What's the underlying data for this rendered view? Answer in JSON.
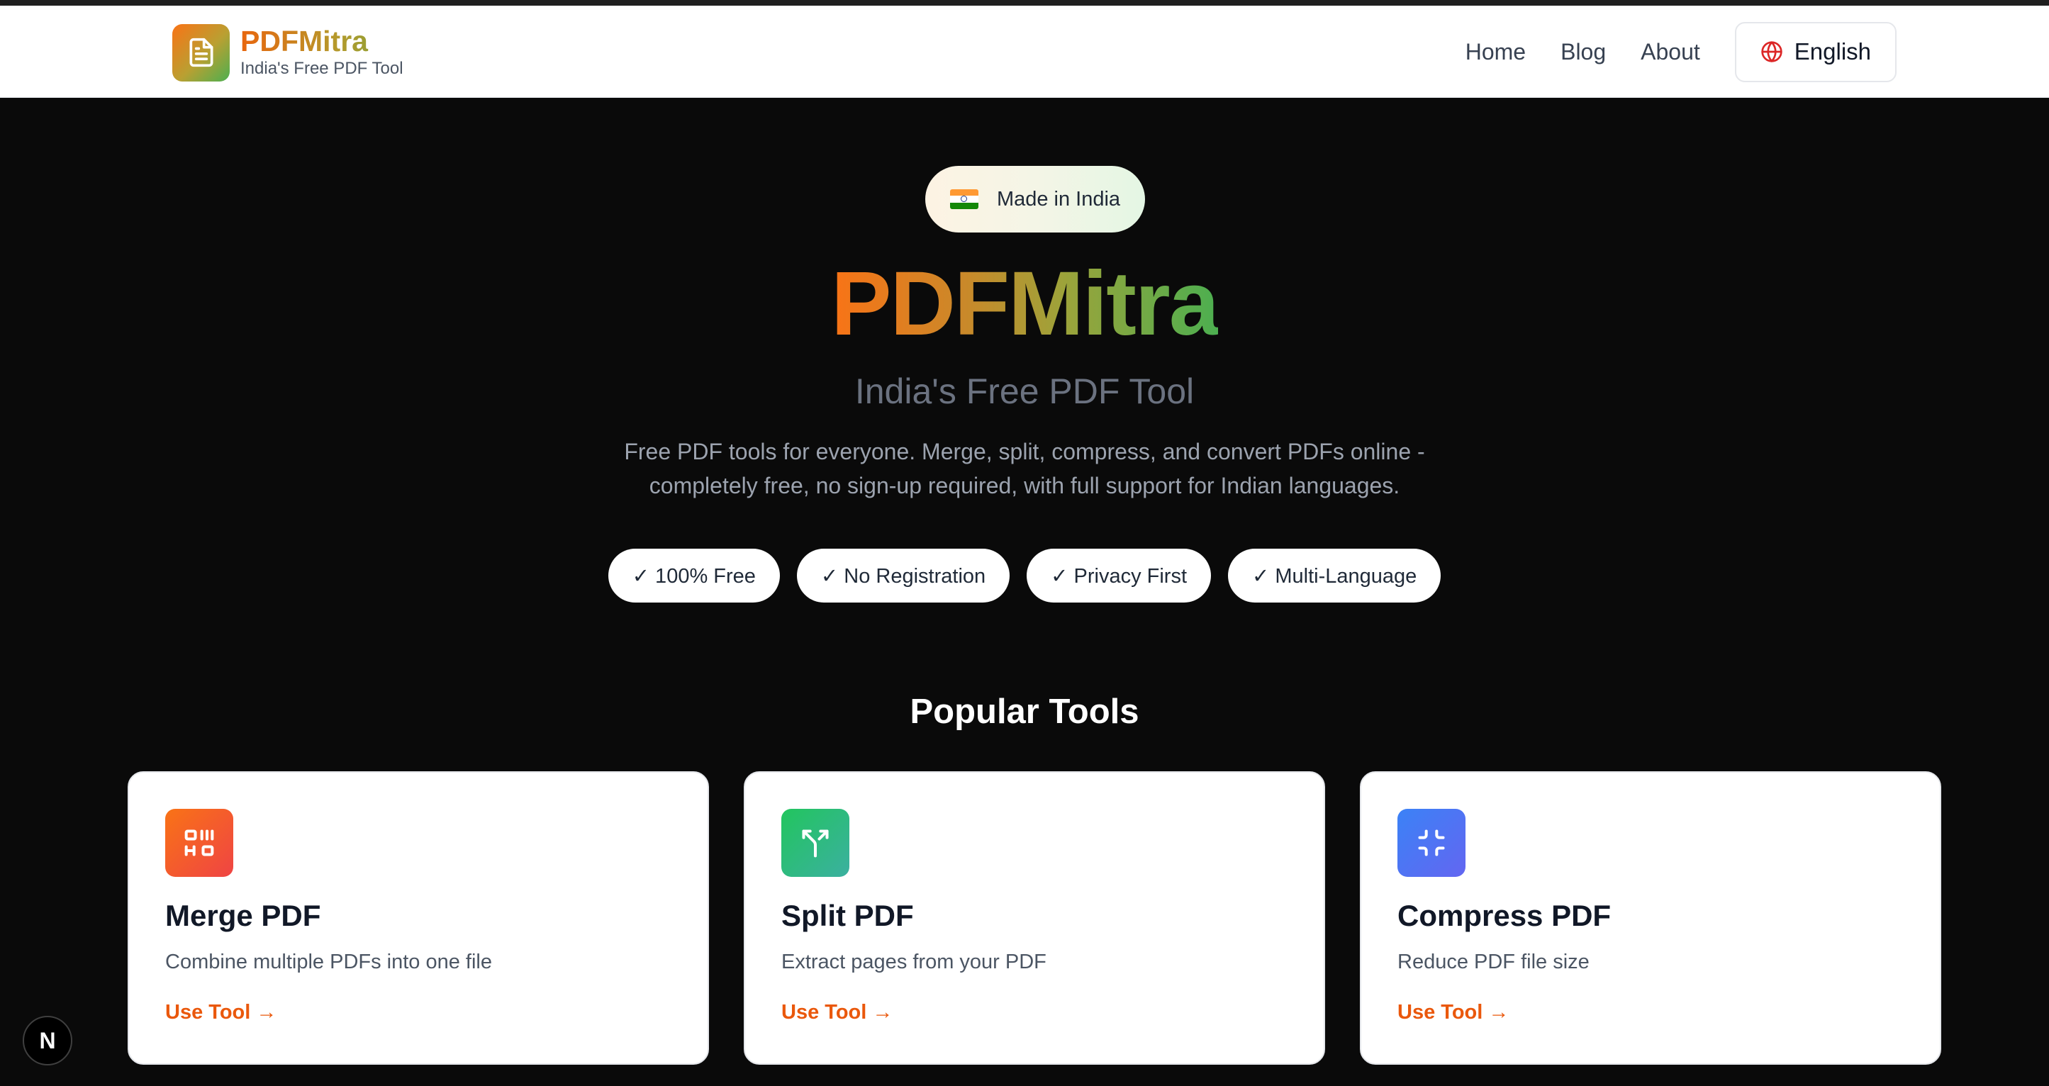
{
  "header": {
    "brand_name": "PDFMitra",
    "brand_tagline": "India's Free PDF Tool",
    "nav": [
      {
        "label": "Home"
      },
      {
        "label": "Blog"
      },
      {
        "label": "About"
      }
    ],
    "language": "English"
  },
  "hero": {
    "badge": "Made in India",
    "title": "PDFMitra",
    "subtitle": "India's Free PDF Tool",
    "description": "Free PDF tools for everyone. Merge, split, compress, and convert PDFs online - completely free, no sign-up required, with full support for Indian languages.",
    "features": [
      "✓ 100% Free",
      "✓ No Registration",
      "✓ Privacy First",
      "✓ Multi-Language"
    ]
  },
  "tools": {
    "section_title": "Popular Tools",
    "items": [
      {
        "title": "Merge PDF",
        "description": "Combine multiple PDFs into one file",
        "cta": "Use Tool →",
        "icon": "merge-icon",
        "color_from": "#f97316",
        "color_to": "#ef4444"
      },
      {
        "title": "Split PDF",
        "description": "Extract pages from your PDF",
        "cta": "Use Tool →",
        "icon": "split-icon",
        "color_from": "#22c55e",
        "color_to": "#3bb0a0"
      },
      {
        "title": "Compress PDF",
        "description": "Reduce PDF file size",
        "cta": "Use Tool →",
        "icon": "compress-icon",
        "color_from": "#3b82f6",
        "color_to": "#6366f1"
      }
    ]
  },
  "dev_badge": "N"
}
